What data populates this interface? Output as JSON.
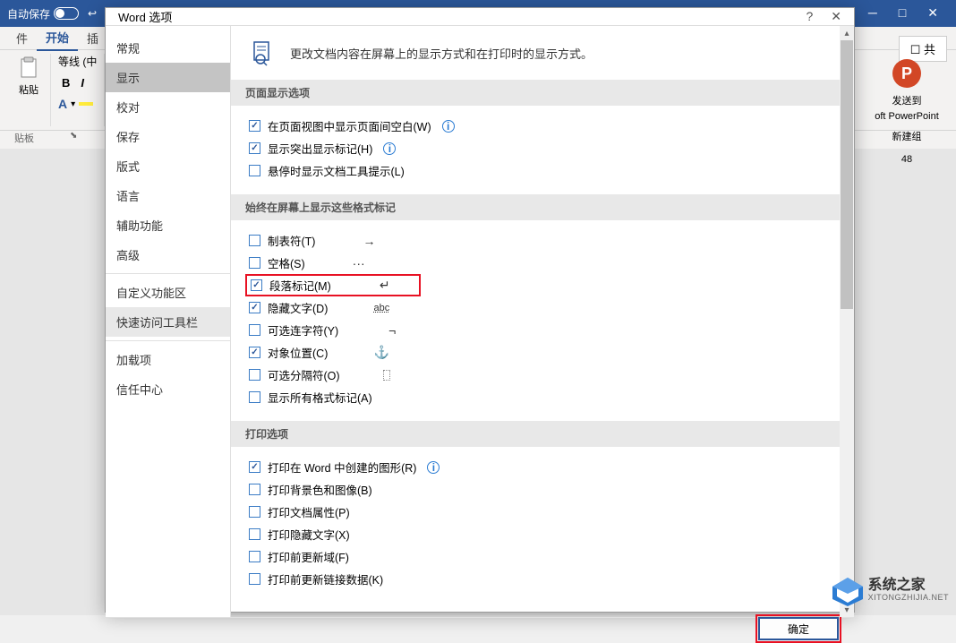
{
  "titlebar": {
    "autosave": "自动保存",
    "minimize": "─",
    "maximize": "□",
    "close": "✕"
  },
  "ribbon": {
    "tabs": {
      "file": "件",
      "home": "开始",
      "insert": "插"
    },
    "font_name": "等线 (中",
    "bold": "B",
    "italic": "I",
    "label_clipboard": "贴板",
    "share": "共"
  },
  "right_panel": {
    "send_to": "发送到",
    "target": "oft PowerPoint",
    "new_group": "新建组",
    "number": "48"
  },
  "dialog": {
    "title": "Word 选项",
    "help": "?",
    "close": "✕",
    "nav": [
      "常规",
      "显示",
      "校对",
      "保存",
      "版式",
      "语言",
      "辅助功能",
      "高级",
      "自定义功能区",
      "快速访问工具栏",
      "加载项",
      "信任中心"
    ],
    "intro": "更改文档内容在屏幕上的显示方式和在打印时的显示方式。",
    "section1": {
      "title": "页面显示选项",
      "opt1": "在页面视图中显示页面间空白(W)",
      "opt2": "显示突出显示标记(H)",
      "opt3": "悬停时显示文档工具提示(L)"
    },
    "section2": {
      "title": "始终在屏幕上显示这些格式标记",
      "opt1": "制表符(T)",
      "sym1": "→",
      "opt2": "空格(S)",
      "sym2": "···",
      "opt3": "段落标记(M)",
      "sym3": "↵",
      "opt4": "隐藏文字(D)",
      "sym4": "abc̲",
      "opt5": "可选连字符(Y)",
      "sym5": "¬",
      "opt6": "对象位置(C)",
      "sym6": "⚓",
      "opt7": "可选分隔符(O)",
      "sym7": "",
      "opt8": "显示所有格式标记(A)"
    },
    "section3": {
      "title": "打印选项",
      "opt1": "打印在 Word 中创建的图形(R)",
      "opt2": "打印背景色和图像(B)",
      "opt3": "打印文档属性(P)",
      "opt4": "打印隐藏文字(X)",
      "opt5": "打印前更新域(F)",
      "opt6": "打印前更新链接数据(K)"
    },
    "buttons": {
      "ok": "确定"
    }
  },
  "watermark": {
    "brand": "系统之家",
    "url": "XITONGZHIJIA.NET"
  }
}
